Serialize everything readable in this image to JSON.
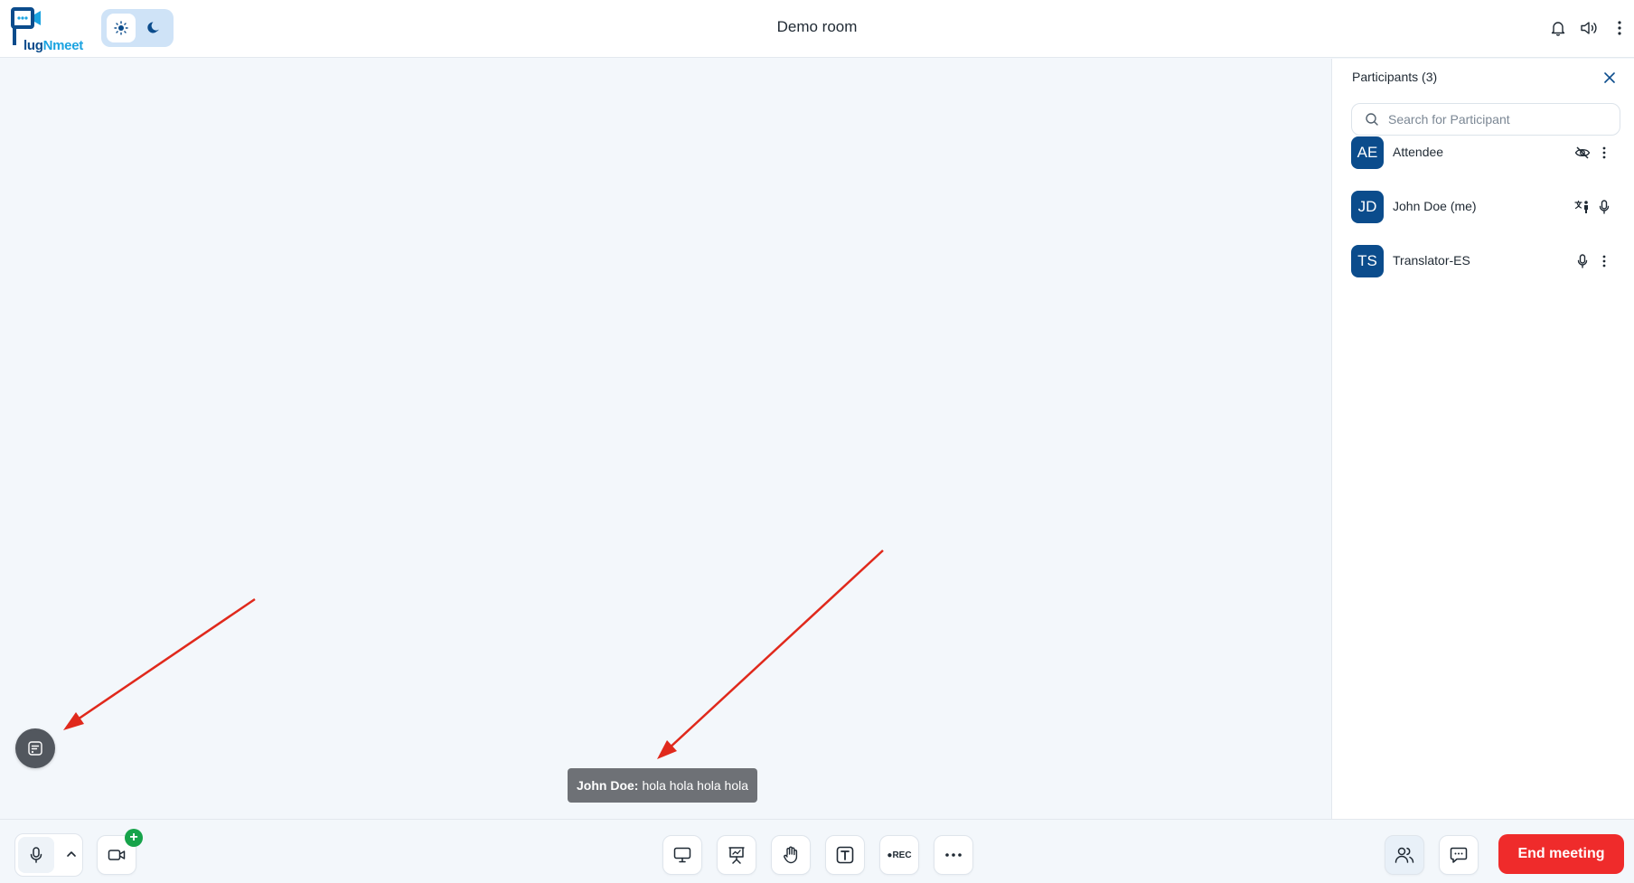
{
  "app": {
    "logo_text_dark": "lug",
    "logo_text_accent": "Nmeet",
    "logo_prefix": "P"
  },
  "header": {
    "room_title": "Demo room",
    "icons": [
      "sun-icon",
      "moon-icon",
      "bell-icon",
      "volume-icon",
      "more-vertical-icon"
    ]
  },
  "sidebar": {
    "title": "Participants (3)",
    "search": {
      "placeholder": "Search for Participant",
      "value": ""
    },
    "participants": [
      {
        "initials": "AE",
        "name": "Attendee",
        "icons": [
          "eye-off-icon",
          "more-vertical-icon"
        ]
      },
      {
        "initials": "JD",
        "name": "John Doe (me)",
        "icons": [
          "translate-icon",
          "mic-icon"
        ]
      },
      {
        "initials": "TS",
        "name": "Translator-ES",
        "icons": [
          "mic-icon",
          "more-vertical-icon"
        ]
      }
    ],
    "avatar_color": "#0b4c8c"
  },
  "caption": {
    "speaker": "John Doe:",
    "text": "hola hola hola hola"
  },
  "footer": {
    "center_controls": [
      "screen-share-icon",
      "presentation-icon",
      "raise-hand-icon",
      "text-icon",
      "recording-icon",
      "more-horizontal-icon"
    ],
    "rec_label": "●REC",
    "right_controls": [
      "participants-icon",
      "chat-icon"
    ],
    "end_meeting_label": "End meeting"
  },
  "colors": {
    "primary": "#0b4c8c",
    "danger": "#ef2b2b",
    "success": "#16a34a",
    "annotation_arrow": "#e0291c"
  }
}
